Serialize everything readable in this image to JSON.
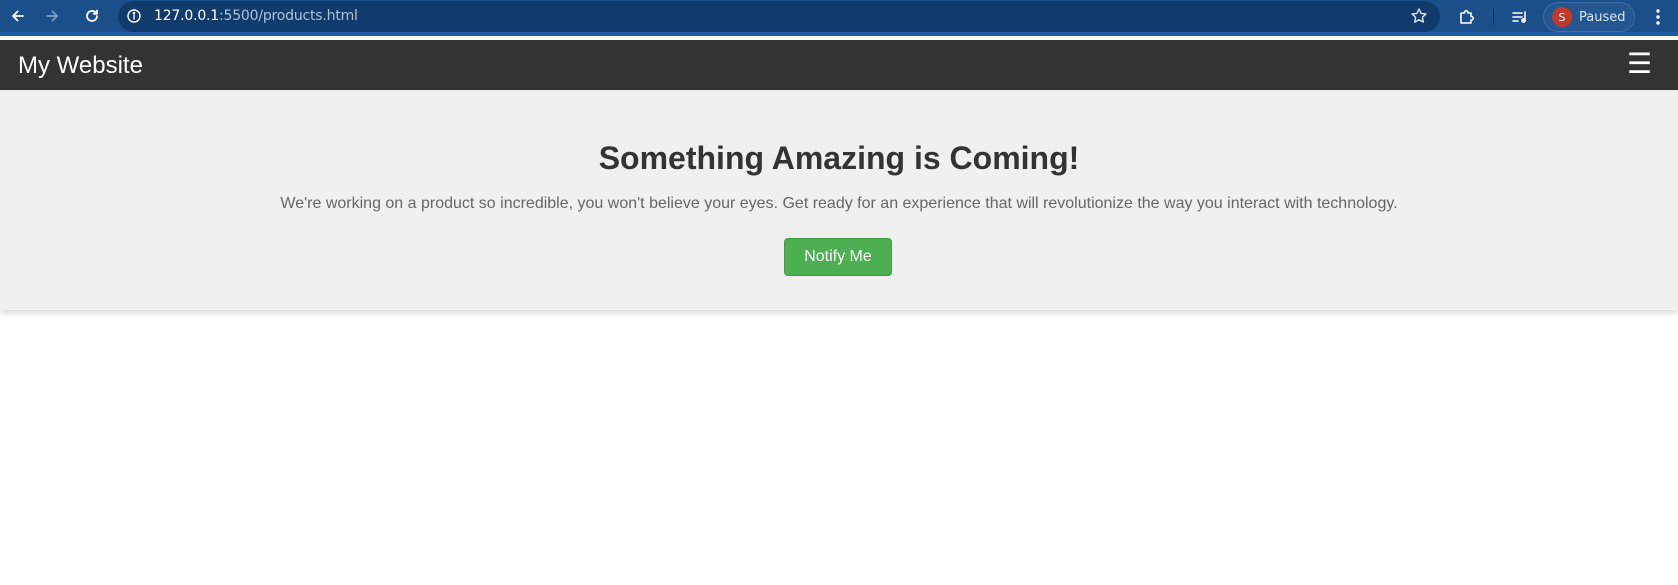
{
  "browser": {
    "url_host": "127.0.0.1",
    "url_rest": ":5500/products.html",
    "profile_initial": "S",
    "profile_status": "Paused",
    "icons": {
      "back": "arrow-left-icon",
      "forward": "arrow-right-icon",
      "reload": "reload-icon",
      "site_info": "info-icon",
      "bookmark": "star-icon",
      "extensions": "puzzle-icon",
      "media": "media-queue-icon",
      "menu": "more-vert-icon"
    },
    "colors": {
      "toolbar": "#1b4f8a",
      "omnibox": "#123b6d",
      "avatar": "#c0392b"
    }
  },
  "site": {
    "logo": "My Website",
    "menu_glyph": "☰",
    "header_color": "#333333"
  },
  "hero": {
    "title": "Something Amazing is Coming!",
    "description": "We're working on a product so incredible, you won't believe your eyes. Get ready for an experience that will revolutionize the way you interact with technology.",
    "button_label": "Notify Me",
    "button_color": "#4caf50",
    "background": "#f0f0f0"
  }
}
